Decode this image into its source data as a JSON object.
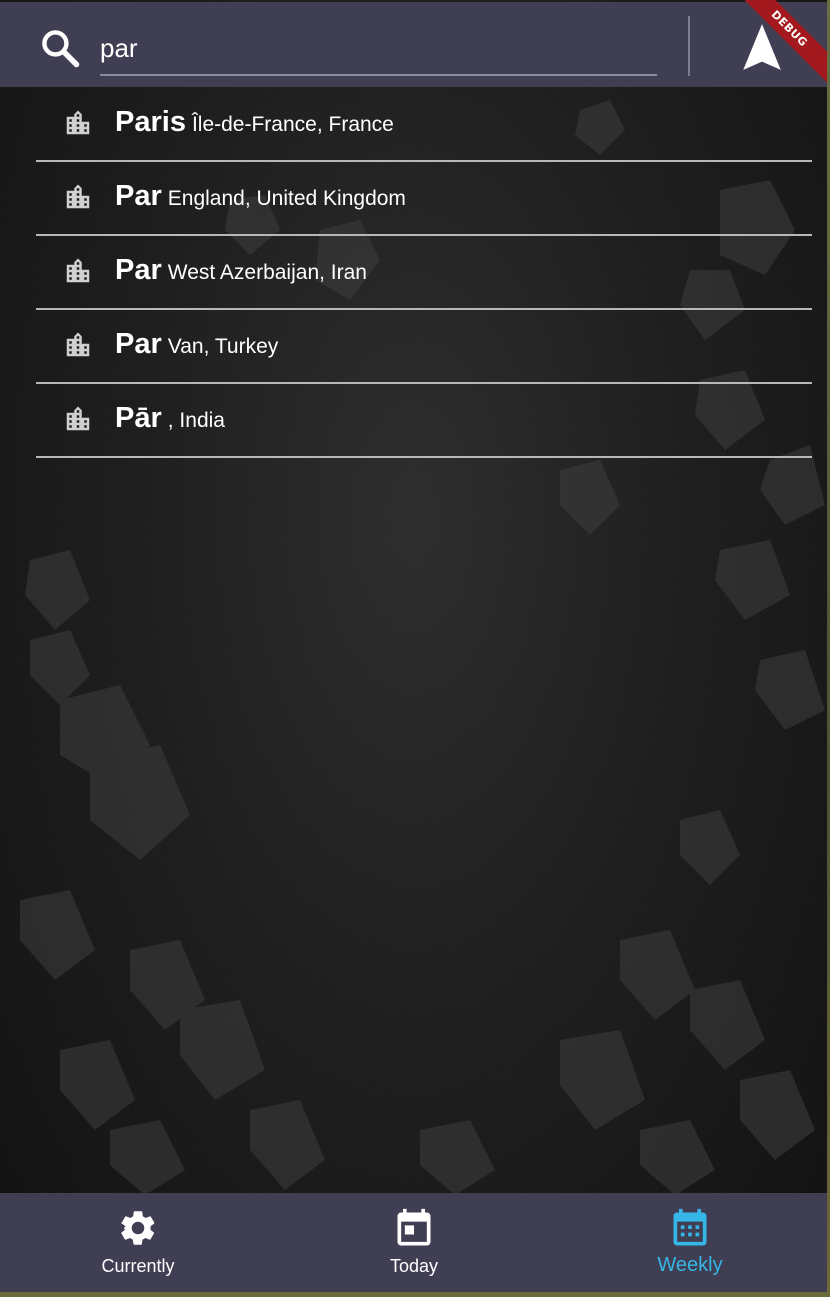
{
  "search": {
    "query": "par"
  },
  "debug_banner": "DEBUG",
  "results": [
    {
      "name": "Paris",
      "region": "Île-de-France, France"
    },
    {
      "name": "Par",
      "region": "England, United Kingdom"
    },
    {
      "name": "Par",
      "region": "West Azerbaijan, Iran"
    },
    {
      "name": "Par",
      "region": "Van, Turkey"
    },
    {
      "name": "Pār",
      "region": ", India"
    }
  ],
  "bottom_nav": {
    "tabs": [
      {
        "label": "Currently",
        "icon": "gear-icon"
      },
      {
        "label": "Today",
        "icon": "calendar-today-icon"
      },
      {
        "label": "Weekly",
        "icon": "calendar-week-icon",
        "active": true
      }
    ]
  },
  "colors": {
    "bar_background": "#403e52",
    "active_tab": "#35b6e6",
    "debug_ribbon": "#a3191d"
  }
}
